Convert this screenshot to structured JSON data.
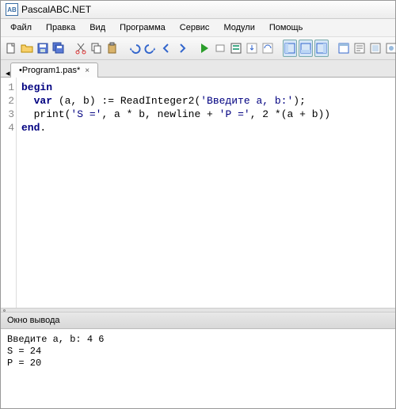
{
  "title": "PascalABC.NET",
  "menu": [
    "Файл",
    "Правка",
    "Вид",
    "Программа",
    "Сервис",
    "Модули",
    "Помощь"
  ],
  "tab": {
    "label": "•Program1.pas*",
    "close": "×"
  },
  "code": {
    "lines": [
      {
        "n": 1,
        "html": "<span class='kw'>begin</span>"
      },
      {
        "n": 2,
        "html": "  <span class='kw'>var</span> (a, b) := ReadInteger2(<span class='str'>'Введите a, b:'</span>);"
      },
      {
        "n": 3,
        "html": "  print(<span class='str'>'S ='</span>, a * b, newline + <span class='str'>'P ='</span>, 2 *(a + b))"
      },
      {
        "n": 4,
        "html": "<span class='kw'>end</span>."
      }
    ]
  },
  "output": {
    "title": "Окно вывода",
    "text": "Введите a, b: 4 6\nS = 24\nP = 20"
  },
  "icons": {
    "new": "new-file-icon",
    "open": "open-folder-icon",
    "save": "save-icon",
    "saveall": "save-all-icon",
    "cut": "cut-icon",
    "copy": "copy-icon",
    "paste": "paste-icon",
    "undo": "undo-icon",
    "redo": "redo-icon",
    "nav-back": "nav-back-icon",
    "nav-fwd": "nav-fwd-icon",
    "run": "run-icon",
    "stop": "stop-icon",
    "compile": "compile-icon",
    "stepinto": "step-into-icon",
    "stepover": "step-over-icon",
    "panel1": "panel-a-icon",
    "panel2": "panel-b-icon",
    "panel3": "panel-c-icon",
    "win1": "window-a-icon",
    "win2": "window-b-icon",
    "win3": "window-c-icon",
    "win4": "window-d-icon"
  }
}
